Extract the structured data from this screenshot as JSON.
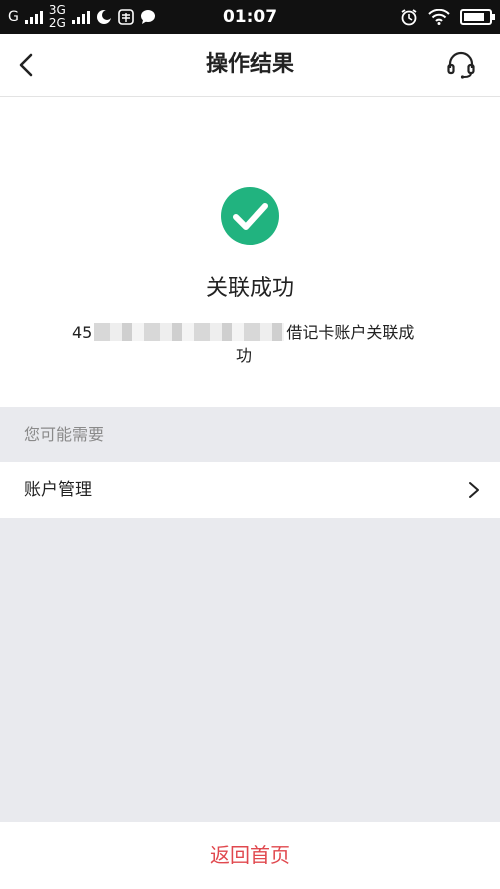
{
  "status_bar": {
    "carrier_1": "G",
    "net_3g": "3G",
    "net_2g": "2G",
    "time": "01:07",
    "icons": [
      "signal-icon",
      "moon-icon",
      "browser-icon",
      "chat-icon",
      "alarm-icon",
      "wifi-icon",
      "battery-icon"
    ],
    "battery_level": 0.85
  },
  "nav": {
    "title": "操作结果",
    "back_icon": "chevron-left-icon",
    "support_icon": "headset-icon"
  },
  "result": {
    "status_icon": "check-circle-icon",
    "status_text": "关联成功",
    "detail_prefix": "45",
    "detail_suffix": "借记卡账户关联成",
    "detail_wrap": "功",
    "accent_color": "#21b37f"
  },
  "suggest": {
    "heading": "您可能需要",
    "items": [
      {
        "label": "账户管理"
      }
    ]
  },
  "footer": {
    "home_label": "返回首页",
    "button_color": "#e0484e"
  }
}
